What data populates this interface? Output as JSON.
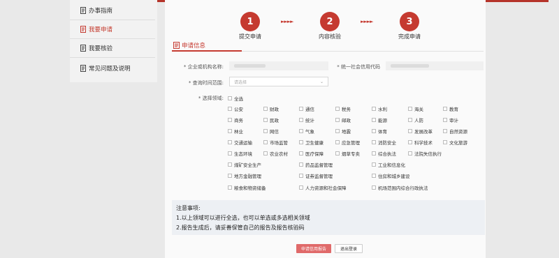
{
  "theme": {
    "accent": "#c53a30",
    "button_primary": "#e06a6a"
  },
  "sidebar": {
    "items": [
      {
        "label": "办事指南",
        "icon": "document-icon",
        "active": false
      },
      {
        "label": "我要申请",
        "icon": "document-icon",
        "active": true
      },
      {
        "label": "我要核验",
        "icon": "document-icon",
        "active": false
      },
      {
        "label": "常见问题及说明",
        "icon": "document-icon",
        "active": false
      }
    ]
  },
  "steps": [
    {
      "number": "1",
      "label": "提交申请"
    },
    {
      "number": "2",
      "label": "内容核验"
    },
    {
      "number": "3",
      "label": "完成申请"
    }
  ],
  "step_arrow": "►►►►",
  "section": {
    "title": "申请信息",
    "icon": "form-icon"
  },
  "form": {
    "company_label": "* 企业或机构名称:",
    "credit_code_label": "* 统一社会信用代码",
    "time_label": "* 查询时间范围:",
    "time_placeholder": "请选择",
    "domain_label": "* 选择领域:",
    "select_all": "全选",
    "domains": [
      "公安",
      "财政",
      "通信",
      "税务",
      "水利",
      "海关",
      "教育",
      "商务",
      "民政",
      "统计",
      "邮政",
      "能源",
      "人防",
      "审计",
      "林业",
      "网信",
      "气象",
      "地震",
      "体育",
      "发展改革",
      "自然资源",
      "交通运输",
      "市场监管",
      "卫生健康",
      "应急管理",
      "消防安全",
      "科学技术",
      "文化旅游",
      "生态环境",
      "农业农村",
      "医疗保障",
      "烟草专卖",
      "综合执法",
      "法院失信执行",
      "煤矿安全生产",
      "药品监督管理",
      "工业和信息化",
      "地方金融管理",
      "证券监督管理",
      "住房和城乡建设",
      "粮食和物资储备",
      "人力资源和社会保障",
      "机场范围内综合行政执法"
    ]
  },
  "notes": {
    "title": "注意事项:",
    "lines": [
      "1.以上领域可以进行全选，也可以单选或多选相关领域",
      "2.报告生成后，请妥善保管自己的报告及报告核验码"
    ]
  },
  "buttons": {
    "submit": "申请信用报告",
    "logout": "退出登录"
  }
}
